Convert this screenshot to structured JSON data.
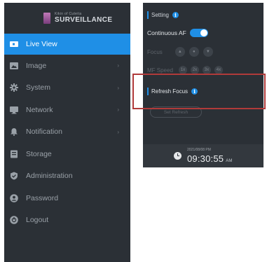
{
  "brand": {
    "small": "Kikin of Cuteita",
    "name": "SURVEILLANCE"
  },
  "sidebar": {
    "items": [
      {
        "label": "Live View",
        "icon": "live-view-icon",
        "active": true,
        "arrow": ""
      },
      {
        "label": "Image",
        "icon": "image-icon",
        "active": false,
        "arrow": "›"
      },
      {
        "label": "System",
        "icon": "gear-icon",
        "active": false,
        "arrow": "›"
      },
      {
        "label": "Network",
        "icon": "monitor-icon",
        "active": false,
        "arrow": "›"
      },
      {
        "label": "Notification",
        "icon": "bell-icon",
        "active": false,
        "arrow": "›"
      },
      {
        "label": "Storage",
        "icon": "storage-icon",
        "active": false,
        "arrow": ""
      },
      {
        "label": "Administration",
        "icon": "shield-icon",
        "active": false,
        "arrow": ""
      },
      {
        "label": "Password",
        "icon": "user-icon",
        "active": false,
        "arrow": ""
      },
      {
        "label": "Logout",
        "icon": "power-icon",
        "active": false,
        "arrow": ""
      }
    ]
  },
  "settings": {
    "title": "Setting",
    "continuous_af_label": "Continuous AF",
    "continuous_af_on": true,
    "focus_label": "Focus",
    "mf_speed_label": "MF Speed",
    "mf_speed_options": [
      "1x",
      "2x",
      "3x",
      "4x"
    ],
    "refresh_focus_label": "Refresh Focus",
    "refresh_button_label": "Set Refresh"
  },
  "clock": {
    "date": "2021/08/08 PM",
    "time": "09:30:55",
    "ampm": "AM"
  },
  "colors": {
    "accent": "#1f8fe6",
    "sidebar_bg": "#2b3036",
    "highlight": "#b03a3a"
  }
}
